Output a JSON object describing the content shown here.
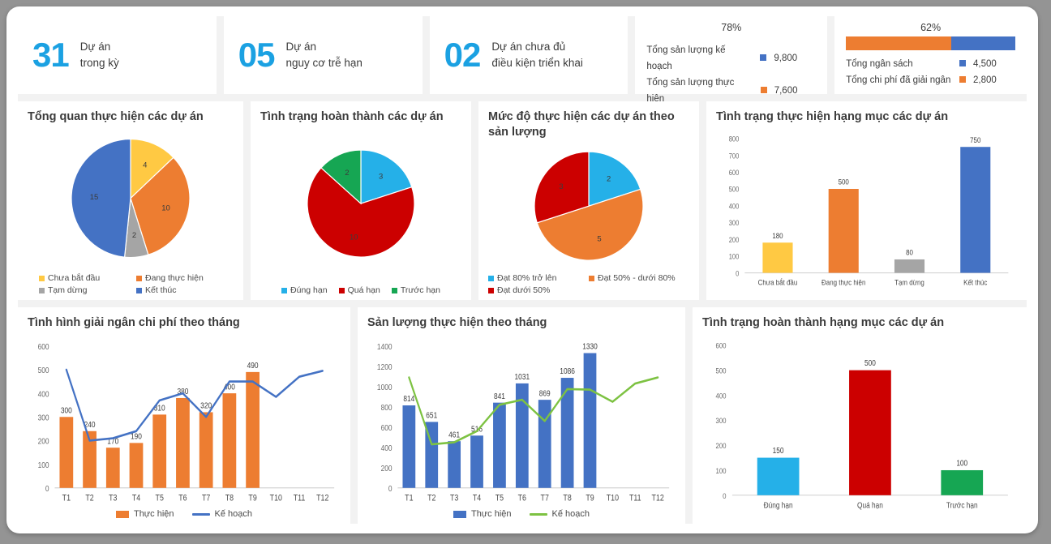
{
  "colors": {
    "blue": "#4472C4",
    "orange": "#ED7D31",
    "yellow": "#FFC943",
    "gray": "#A5A5A5",
    "cyan": "#25B0E8",
    "red": "#CC0000",
    "green": "#16A653",
    "line_green": "#7DC242",
    "kpi_number": "#1BA1E2"
  },
  "kpi_cards": [
    {
      "number": "31",
      "label_line1": "Dự án",
      "label_line2": "trong kỳ"
    },
    {
      "number": "05",
      "label_line1": "Dự án",
      "label_line2": "nguy cơ trễ hạn"
    },
    {
      "number": "02",
      "label_line1": "Dự án chưa đủ",
      "label_line2": "điều kiện triển khai"
    }
  ],
  "progress_cards": [
    {
      "percent_label": "78%",
      "percent_value": 78,
      "rows": [
        {
          "name": "Tổng sản lượng kế hoạch",
          "value": "9,800",
          "color": "#4472C4"
        },
        {
          "name": "Tổng sản lượng thực hiện",
          "value": "7,600",
          "color": "#ED7D31"
        }
      ]
    },
    {
      "percent_label": "62%",
      "percent_value": 62,
      "rows": [
        {
          "name": "Tổng ngân sách",
          "value": "4,500",
          "color": "#4472C4"
        },
        {
          "name": "Tổng chi phí đã giải ngân",
          "value": "2,800",
          "color": "#ED7D31"
        }
      ]
    }
  ],
  "chart_data": [
    {
      "id": "pie-tong-quan",
      "type": "pie",
      "title": "Tổng quan thực hiện các dự án",
      "labels": [
        "Chưa bắt đầu",
        "Đang thực hiện",
        "Tạm dừng",
        "Kết thúc"
      ],
      "values": [
        4,
        10,
        2,
        15
      ],
      "colors": [
        "#FFC943",
        "#ED7D31",
        "#A5A5A5",
        "#4472C4"
      ],
      "legend_position": "bottom"
    },
    {
      "id": "pie-tinh-trang-hoan-thanh",
      "type": "pie",
      "title": "Tình trạng hoàn thành các dự án",
      "labels": [
        "Đúng hạn",
        "Quá hạn",
        "Trước hạn"
      ],
      "values": [
        3,
        10,
        2
      ],
      "colors": [
        "#25B0E8",
        "#CC0000",
        "#16A653"
      ],
      "legend_position": "bottom"
    },
    {
      "id": "pie-muc-do-thuc-hien",
      "type": "pie",
      "title": "Mức độ thực hiện các dự án theo sản lượng",
      "labels": [
        "Đạt 80% trở lên",
        "Đạt 50% - dưới 80%",
        "Đạt dưới 50%"
      ],
      "values": [
        2,
        5,
        3
      ],
      "colors": [
        "#25B0E8",
        "#ED7D31",
        "#CC0000"
      ],
      "legend_position": "bottom"
    },
    {
      "id": "bar-hang-muc-thuc-hien",
      "type": "bar",
      "title": "Tình trạng thực hiện hạng mục các dự án",
      "categories": [
        "Chưa bắt đầu",
        "Đang thực hiện",
        "Tạm dừng",
        "Kết thúc"
      ],
      "values": [
        180,
        500,
        80,
        750
      ],
      "colors": [
        "#FFC943",
        "#ED7D31",
        "#A5A5A5",
        "#4472C4"
      ],
      "yticks": [
        0,
        100,
        200,
        300,
        400,
        500,
        600,
        700,
        800
      ],
      "ylim": [
        0,
        800
      ],
      "xlabel": "",
      "ylabel": "",
      "grid": false
    },
    {
      "id": "combo-giai-ngan-chi-phi",
      "type": "bar",
      "title": "Tình hình giải ngân chi phí theo tháng",
      "categories": [
        "T1",
        "T2",
        "T3",
        "T4",
        "T5",
        "T6",
        "T7",
        "T8",
        "T9",
        "T10",
        "T11",
        "T12"
      ],
      "series": [
        {
          "name": "Thực hiện",
          "type": "bar",
          "color": "#ED7D31",
          "values": [
            300,
            240,
            170,
            190,
            310,
            380,
            320,
            400,
            490,
            null,
            null,
            null
          ]
        },
        {
          "name": "Kế hoạch",
          "type": "line",
          "color": "#4472C4",
          "values": [
            500,
            200,
            210,
            240,
            370,
            400,
            300,
            450,
            450,
            385,
            470,
            495
          ]
        }
      ],
      "yticks": [
        0,
        100,
        200,
        300,
        400,
        500,
        600
      ],
      "ylim": [
        0,
        600
      ],
      "grid": false,
      "legend_position": "bottom"
    },
    {
      "id": "combo-san-luong-thuc-hien",
      "type": "bar",
      "title": "Sản lượng thực hiện theo tháng",
      "categories": [
        "T1",
        "T2",
        "T3",
        "T4",
        "T5",
        "T6",
        "T7",
        "T8",
        "T9",
        "T10",
        "T11",
        "T12"
      ],
      "series": [
        {
          "name": "Thực hiện",
          "type": "bar",
          "color": "#4472C4",
          "values": [
            814,
            651,
            461,
            516,
            841,
            1031,
            869,
            1086,
            1330,
            null,
            null,
            null
          ]
        },
        {
          "name": "Kế hoạch",
          "type": "line",
          "color": "#7DC242",
          "values": [
            1090,
            430,
            450,
            560,
            820,
            870,
            660,
            975,
            970,
            850,
            1030,
            1090
          ]
        }
      ],
      "yticks": [
        0,
        200,
        400,
        600,
        800,
        1000,
        1200,
        1400
      ],
      "ylim": [
        0,
        1400
      ],
      "grid": false,
      "legend_position": "bottom"
    },
    {
      "id": "bar-hoan-thanh-hang-muc",
      "type": "bar",
      "title": "Tình trạng hoàn thành hạng mục các dự án",
      "categories": [
        "Đúng hạn",
        "Quá hạn",
        "Trước hạn"
      ],
      "values": [
        150,
        500,
        100
      ],
      "colors": [
        "#25B0E8",
        "#CC0000",
        "#16A653"
      ],
      "yticks": [
        0,
        100,
        200,
        300,
        400,
        500,
        600
      ],
      "ylim": [
        0,
        600
      ],
      "grid": false
    }
  ]
}
